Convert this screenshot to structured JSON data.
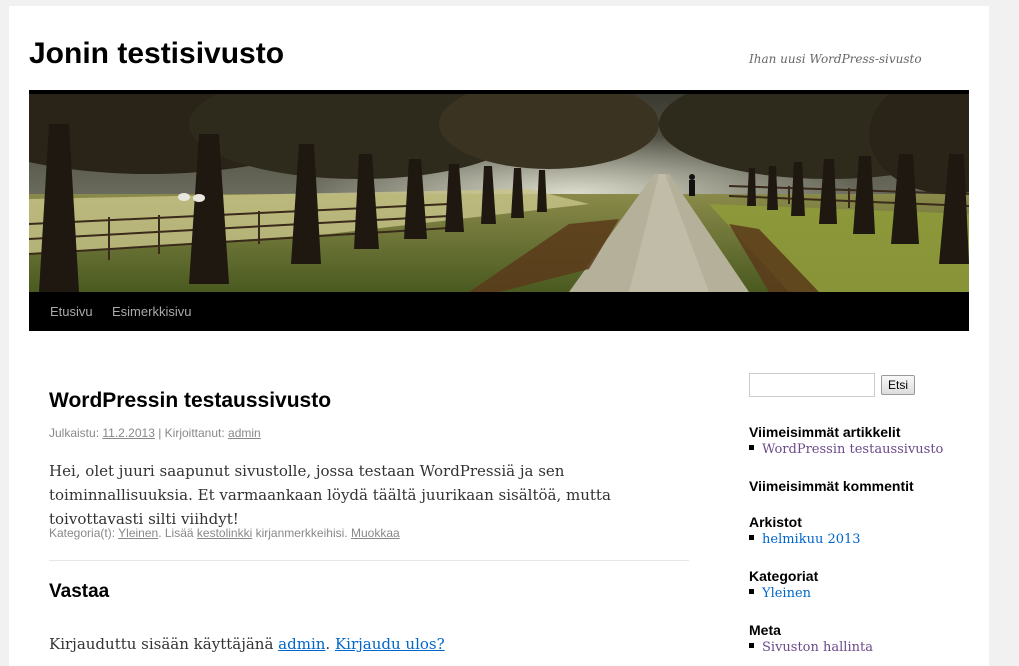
{
  "site": {
    "title": "Jonin testisivusto",
    "description": "Ihan uusi WordPress-sivusto"
  },
  "nav": {
    "items": [
      "Etusivu",
      "Esimerkkisivu"
    ]
  },
  "post": {
    "title": "WordPressin testaussivusto",
    "meta_published_label": "Julkaistu:",
    "date": "11.2.2013",
    "meta_author_label": "| Kirjoittanut:",
    "author": "admin",
    "body": "Hei, olet juuri saapunut sivustolle, jossa testaan WordPressiä ja sen toiminnallisuuksia. Et varmaankaan löydä täältä juurikaan sisältöä, mutta toivottavasti silti viihdyt!",
    "utility_category_label": "Kategoria(t):",
    "category": "Yleinen",
    "utility_add_label": ". Lisää",
    "permalink_label": "kestolinkki",
    "utility_bookmarks_label": "kirjanmerkkeihisi.",
    "edit_label": "Muokkaa"
  },
  "reply": {
    "title": "Vastaa",
    "logged_in_label": "Kirjauduttu sisään käyttäjänä",
    "user": "admin",
    "logout_label": "Kirjaudu ulos?"
  },
  "sidebar": {
    "search_button": "Etsi",
    "search_value": "",
    "recent_posts_title": "Viimeisimmät artikkelit",
    "recent_post": "WordPressin testaussivusto",
    "recent_comments_title": "Viimeisimmät kommentit",
    "archives_title": "Arkistot",
    "archive_item": "helmikuu 2013",
    "categories_title": "Kategoriat",
    "category_item": "Yleinen",
    "meta_title": "Meta",
    "meta_item": "Sivuston hallinta"
  },
  "colors": {
    "link_visited": "#6b4a8a",
    "link": "#0066cc",
    "nav_bg": "#000000"
  }
}
